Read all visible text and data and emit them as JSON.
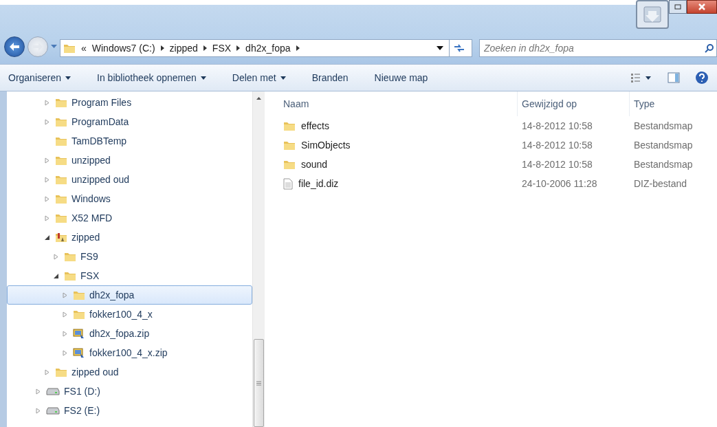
{
  "address_bar": {
    "overflow": "«",
    "crumbs": [
      "Windows7 (C:)",
      "zipped",
      "FSX",
      "dh2x_fopa"
    ]
  },
  "search": {
    "placeholder": "Zoeken in dh2x_fopa"
  },
  "toolbar": {
    "buttons": [
      {
        "label": "Organiseren",
        "dropdown": true
      },
      {
        "label": "In bibliotheek opnemen",
        "dropdown": true
      },
      {
        "label": "Delen met",
        "dropdown": true
      },
      {
        "label": "Branden",
        "dropdown": false
      },
      {
        "label": "Nieuwe map",
        "dropdown": false
      }
    ]
  },
  "sidebar": {
    "drive_c_children": [
      {
        "label": "Program Files",
        "kind": "folder",
        "expanded": false,
        "selected": false
      },
      {
        "label": "ProgramData",
        "kind": "folder",
        "expanded": false,
        "selected": false
      },
      {
        "label": "TamDBTemp",
        "kind": "folder",
        "selected": false
      },
      {
        "label": "unzipped",
        "kind": "folder",
        "expanded": false,
        "selected": false
      },
      {
        "label": "unzipped oud",
        "kind": "folder",
        "expanded": false,
        "selected": false
      },
      {
        "label": "Windows",
        "kind": "folder",
        "expanded": false,
        "selected": false
      },
      {
        "label": "X52 MFD",
        "kind": "folder",
        "expanded": false,
        "selected": false
      },
      {
        "label": "zipped",
        "kind": "zipfolder",
        "expanded": true,
        "selected": false,
        "children": [
          {
            "label": "FS9",
            "kind": "folder",
            "expanded": false,
            "selected": false
          },
          {
            "label": "FSX",
            "kind": "folder",
            "expanded": true,
            "selected": false,
            "children": [
              {
                "label": "dh2x_fopa",
                "kind": "folder",
                "expanded": false,
                "selected": true
              },
              {
                "label": "fokker100_4_x",
                "kind": "folder",
                "expanded": false,
                "selected": false
              },
              {
                "label": "dh2x_fopa.zip",
                "kind": "zip",
                "expanded": false,
                "selected": false
              },
              {
                "label": "fokker100_4_x.zip",
                "kind": "zip",
                "expanded": false,
                "selected": false
              }
            ]
          }
        ]
      },
      {
        "label": "zipped oud",
        "kind": "folder",
        "expanded": false,
        "selected": false
      }
    ],
    "drives": [
      {
        "label": "FS1 (D:)",
        "kind": "drive",
        "expanded": false,
        "selected": false
      },
      {
        "label": "FS2 (E:)",
        "kind": "drive",
        "expanded": false,
        "selected": false
      }
    ]
  },
  "table": {
    "columns": [
      "Naam",
      "Gewijzigd op",
      "Type"
    ],
    "rows": [
      {
        "kind": "folder",
        "name": "effects",
        "modified": "14-8-2012 10:58",
        "type": "Bestandsmap"
      },
      {
        "kind": "folder",
        "name": "SimObjects",
        "modified": "14-8-2012 10:58",
        "type": "Bestandsmap"
      },
      {
        "kind": "folder",
        "name": "sound",
        "modified": "14-8-2012 10:58",
        "type": "Bestandsmap"
      },
      {
        "kind": "file",
        "name": "file_id.diz",
        "modified": "24-10-2006 11:28",
        "type": "DIZ-bestand"
      }
    ]
  }
}
